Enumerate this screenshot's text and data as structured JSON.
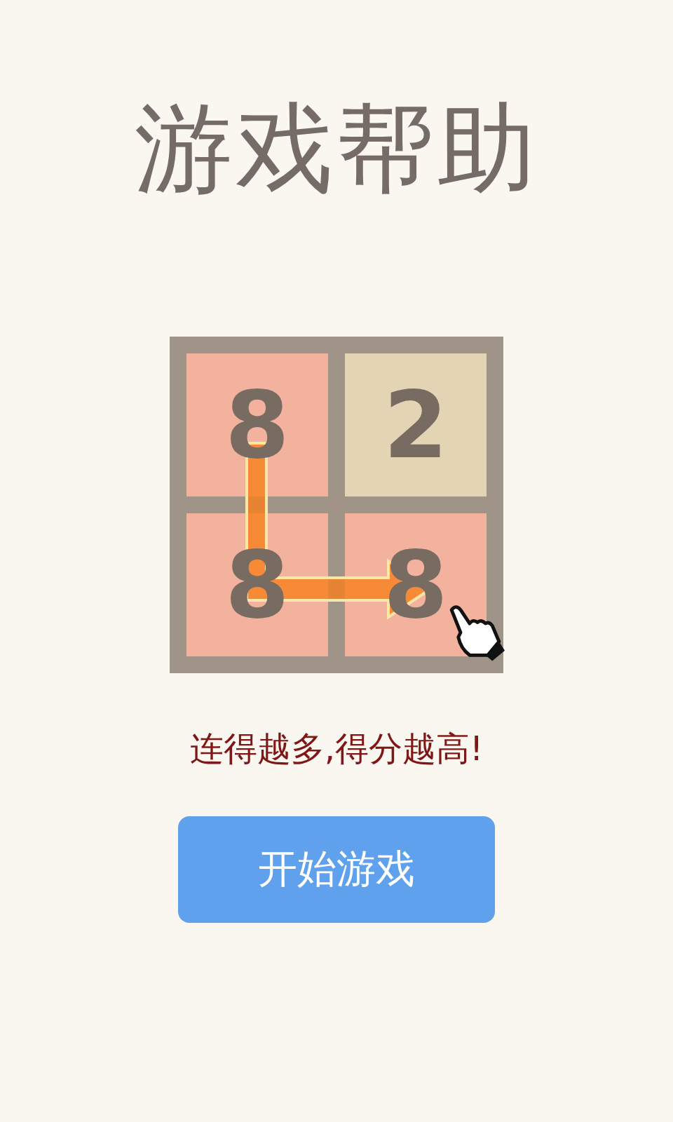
{
  "title": "游戏帮助",
  "tiles": [
    {
      "value": "8",
      "color": "#f2b29d"
    },
    {
      "value": "2",
      "color": "#e3d4b4"
    },
    {
      "value": "8",
      "color": "#f2b29d"
    },
    {
      "value": "8",
      "color": "#f2b29d"
    }
  ],
  "hint": "连得越多,得分越高!",
  "start_button": "开始游戏"
}
